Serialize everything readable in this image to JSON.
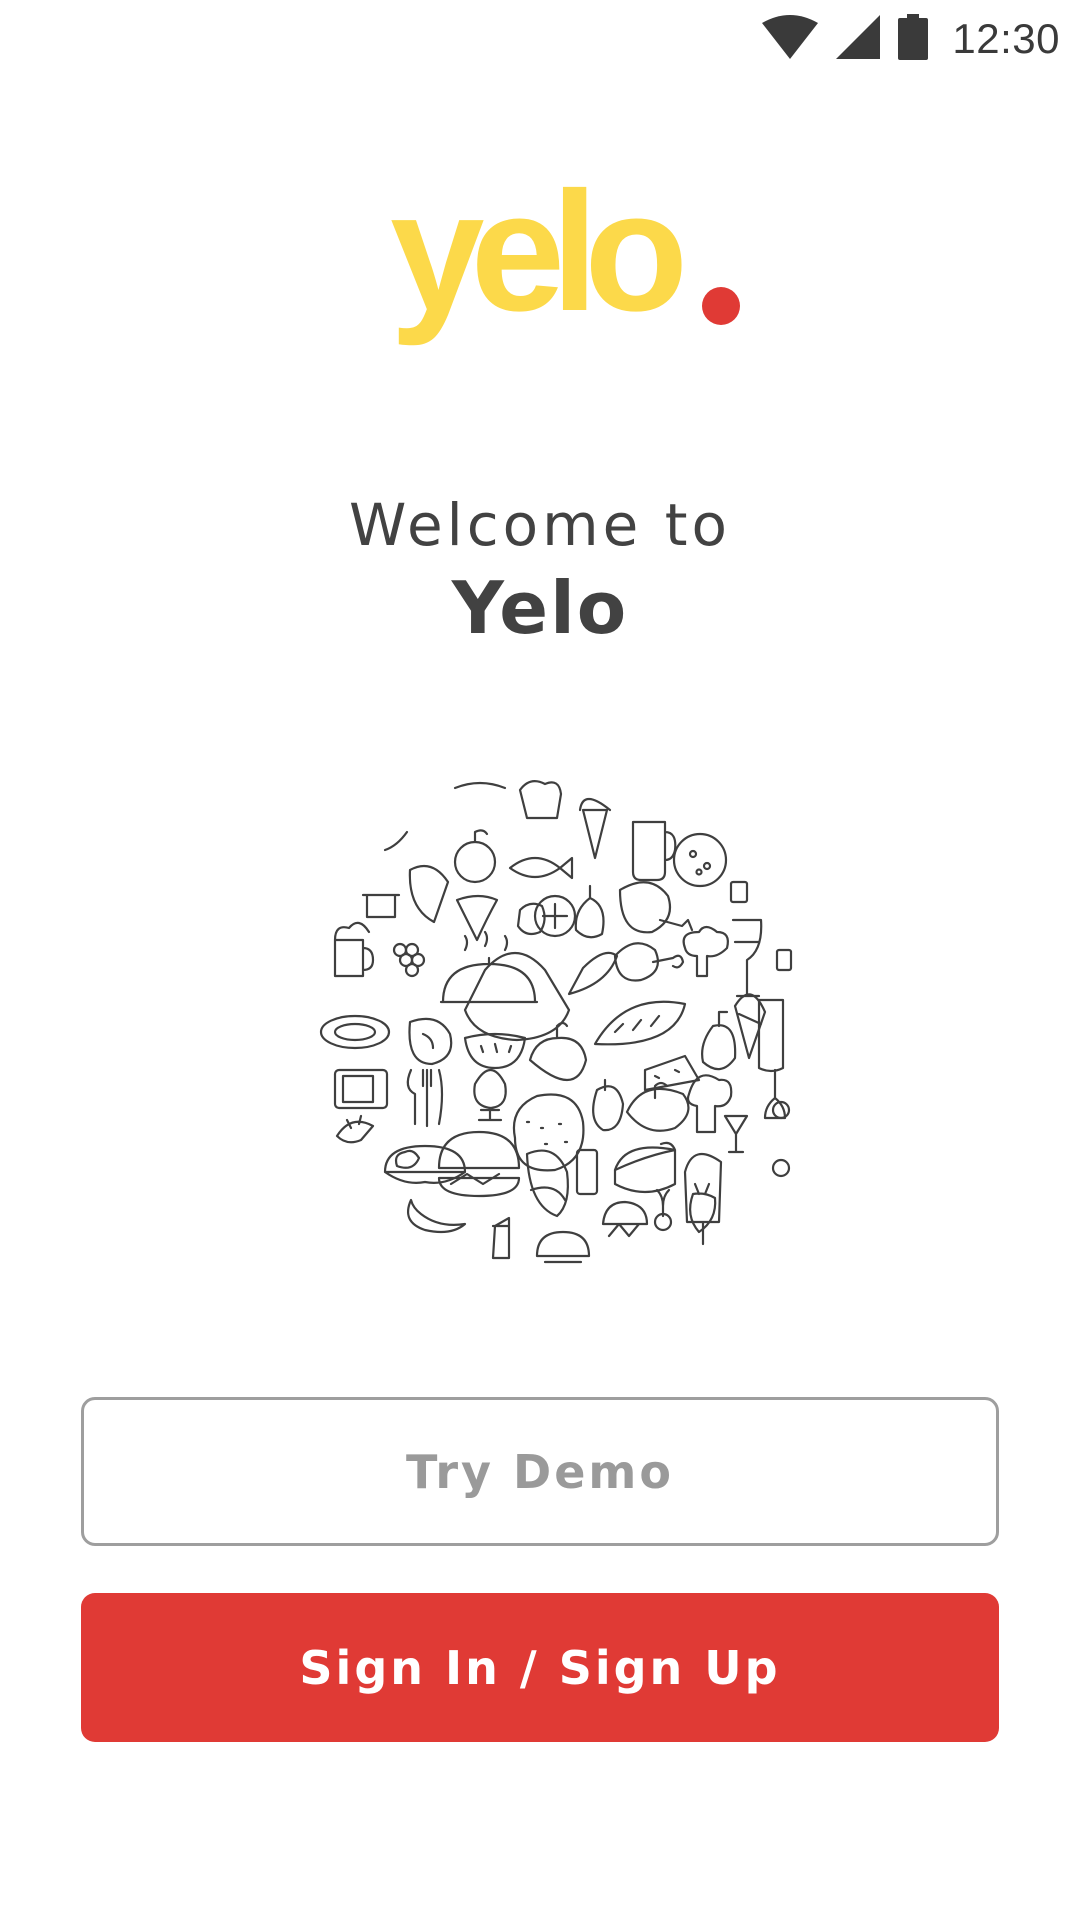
{
  "status_bar": {
    "time": "12:30",
    "icons": [
      "wifi-icon",
      "cellular-signal-icon",
      "battery-icon"
    ]
  },
  "logo": {
    "text": "yelo",
    "brand_color": "#fcd94a",
    "dot_color": "#e03a35"
  },
  "welcome": {
    "line1": "Welcome to",
    "line2": "Yelo"
  },
  "illustration": {
    "icon": "food-doodle-circle-illustration"
  },
  "buttons": {
    "try_demo_label": "Try Demo",
    "sign_in_label": "Sign In / Sign Up",
    "accent_color": "#e03a35"
  }
}
